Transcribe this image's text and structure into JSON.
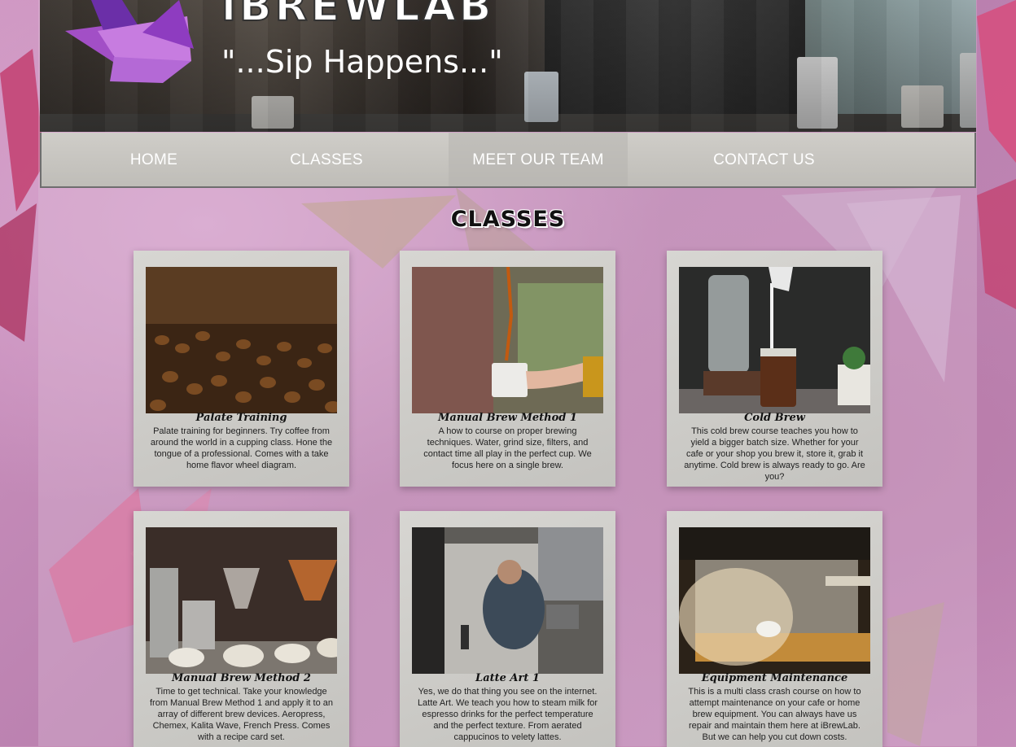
{
  "brand": {
    "name": "iBREWLAB",
    "tagline": "\"...Sip Happens...\""
  },
  "nav": {
    "items": [
      "HOME",
      "CLASSES",
      "MEET OUR TEAM",
      "CONTACT US"
    ]
  },
  "section": {
    "title": "CLASSES"
  },
  "classes": [
    {
      "title": "Palate Training",
      "description": "Palate training for beginners. Try coffee from around the world in a cupping class. Hone the tongue of a professional. Comes with a take home flavor wheel diagram."
    },
    {
      "title": "Manual Brew Method 1",
      "description": "A how to course on proper brewing techniques. Water, grind size, filters, and contact time all play in the perfect cup. We focus here on a single brew."
    },
    {
      "title": "Cold Brew",
      "description": "This cold brew course teaches you how to yield a bigger batch size. Whether for your cafe or your shop you brew it, store it, grab it anytime. Cold brew is always ready to go. Are you?"
    },
    {
      "title": "Manual Brew Method 2",
      "description": "Time to get technical. Take your knowledge from Manual Brew Method 1 and apply it to an array of different brew devices. Aeropress, Chemex, Kalita Wave, French Press. Comes with a recipe card set."
    },
    {
      "title": "Latte Art 1",
      "description": "Yes, we do that thing you see on the internet. Latte Art. We teach you how to steam milk for espresso drinks for the perfect temperature and the perfect texture. From aerated cappucinos to velety lattes."
    },
    {
      "title": "Equipment Maintenance",
      "description": "This is a multi class crash course on how to attempt maintenance on your cafe or home brew equipment. You can always have us repair and maintain them here at iBrewLab. But we can help you cut down costs."
    }
  ]
}
